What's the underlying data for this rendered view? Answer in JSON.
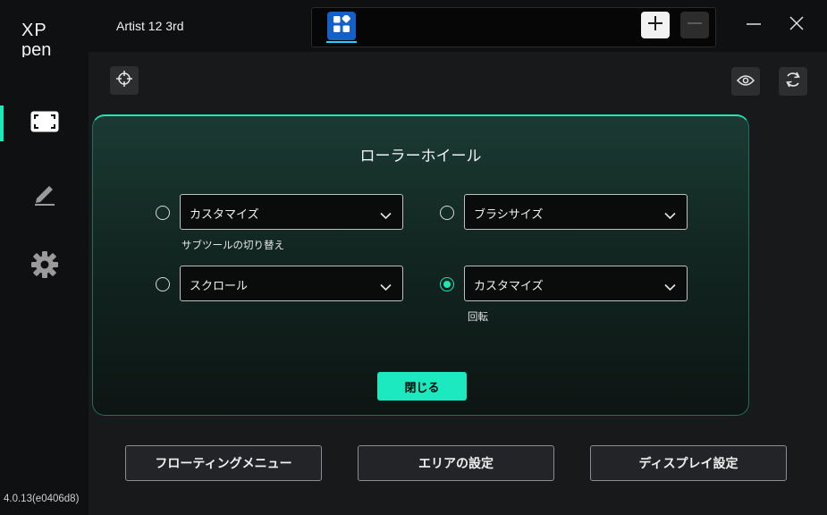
{
  "app": {
    "brand_top": "XP",
    "brand_bottom": "pen",
    "version": "4.0.13(e0406d8)",
    "device_name": "Artist 12 3rd"
  },
  "sidebar": {
    "items": [
      {
        "icon": "display-area-icon",
        "active": true
      },
      {
        "icon": "pen-icon",
        "active": false
      },
      {
        "icon": "gear-icon",
        "active": false
      }
    ]
  },
  "toolbar": {
    "app_tab_icon": "app-grid-icon",
    "add_icon": "plus-icon",
    "remove_icon": "minus-icon"
  },
  "window": {
    "minimize_icon": "minimize-icon",
    "close_icon": "close-icon"
  },
  "tools": {
    "left": "crosshair-icon",
    "right_1": "eye-icon",
    "right_2": "refresh-icon"
  },
  "panel": {
    "title": "ローラーホイール",
    "options": [
      {
        "value": "カスタマイズ",
        "sublabel": "サブツールの切り替え",
        "checked": false
      },
      {
        "value": "ブラシサイズ",
        "sublabel": "",
        "checked": false
      },
      {
        "value": "スクロール",
        "sublabel": "",
        "checked": false
      },
      {
        "value": "カスタマイズ",
        "sublabel": "回転",
        "checked": true
      }
    ],
    "close_label": "閉じる"
  },
  "footer": {
    "floating_menu_label": "フローティングメニュー",
    "area_settings_label": "エリアの設定",
    "display_settings_label": "ディスプレイ設定"
  },
  "colors": {
    "accent": "#1de9b6",
    "background": "#18191b",
    "sidebar": "#0f1011"
  }
}
